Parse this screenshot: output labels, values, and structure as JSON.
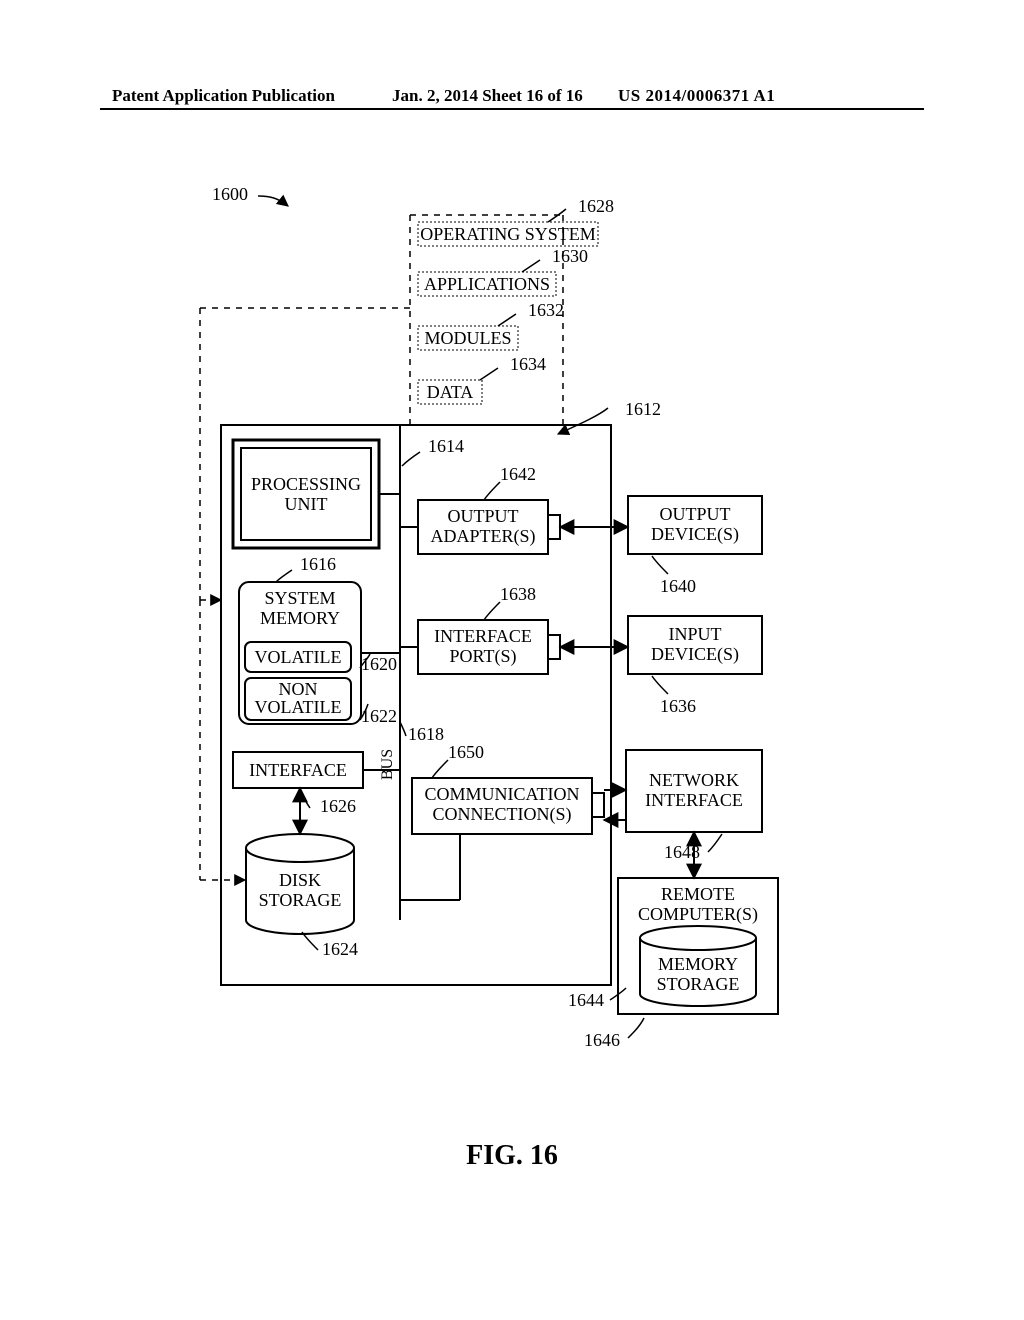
{
  "header": {
    "left": "Patent Application Publication",
    "mid": "Jan. 2, 2014  Sheet 16 of 16",
    "right": "US 2014/0006371 A1"
  },
  "figure_label": "FIG. 16",
  "labels": {
    "main_ref": "1600",
    "os": "OPERATING SYSTEM",
    "os_ref": "1628",
    "apps": "APPLICATIONS",
    "apps_ref": "1630",
    "modules": "MODULES",
    "modules_ref": "1632",
    "data": "DATA",
    "data_ref": "1634",
    "outer_ref": "1612",
    "proc1": "PROCESSING",
    "proc2": "UNIT",
    "proc_ref": "1614",
    "out_adapter1": "OUTPUT",
    "out_adapter2": "ADAPTER(S)",
    "out_adapter_ref": "1642",
    "out_dev1": "OUTPUT",
    "out_dev2": "DEVICE(S)",
    "out_dev_ref": "1640",
    "sysmem1": "SYSTEM",
    "sysmem2": "MEMORY",
    "sysmem_ref": "1616",
    "vol": "VOLATILE",
    "vol_ref": "1620",
    "nonvol1": "NON",
    "nonvol2": "VOLATILE",
    "nonvol_ref": "1622",
    "bus": "BUS",
    "bus_ref": "1618",
    "ifport1": "INTERFACE",
    "ifport2": "PORT(S)",
    "ifport_ref": "1638",
    "input1": "INPUT",
    "input2": "DEVICE(S)",
    "input_ref": "1636",
    "iface": "INTERFACE",
    "iface_ref": "1626",
    "comm1": "COMMUNICATION",
    "comm2": "CONNECTION(S)",
    "comm_ref": "1650",
    "netif1": "NETWORK",
    "netif2": "INTERFACE",
    "netif_ref": "1648",
    "disk1": "DISK",
    "disk2": "STORAGE",
    "disk_ref": "1624",
    "remote1": "REMOTE",
    "remote2": "COMPUTER(S)",
    "remote_ref": "1644",
    "memstore1": "MEMORY",
    "memstore2": "STORAGE",
    "memstore_ref": "1646"
  }
}
